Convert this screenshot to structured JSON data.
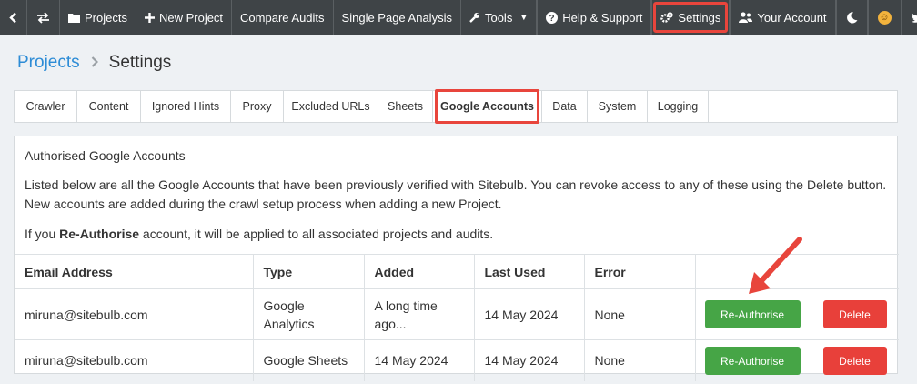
{
  "nav": {
    "projects": "Projects",
    "new_project": "New Project",
    "compare_audits": "Compare Audits",
    "single_page": "Single Page Analysis",
    "tools": "Tools",
    "help": "Help & Support",
    "settings": "Settings",
    "account": "Your Account"
  },
  "breadcrumb": {
    "parent": "Projects",
    "current": "Settings"
  },
  "tabs": [
    "Crawler",
    "Content",
    "Ignored Hints",
    "Proxy",
    "Excluded URLs",
    "Sheets",
    "Google Accounts",
    "Data",
    "System",
    "Logging"
  ],
  "panel": {
    "title": "Authorised Google Accounts",
    "line1": "Listed below are all the Google Accounts that have been previously verified with Sitebulb. You can revoke access to any of these using the Delete button.",
    "line2": "New accounts are added during the crawl setup process when adding a new Project.",
    "line3_prefix": "If you ",
    "line3_bold": "Re-Authorise",
    "line3_suffix": " account, it will be applied to all associated projects and audits."
  },
  "table": {
    "headers": [
      "Email Address",
      "Type",
      "Added",
      "Last Used",
      "Error",
      ""
    ],
    "rows": [
      {
        "email": "miruna@sitebulb.com",
        "type": "Google Analytics",
        "added": "A long time ago...",
        "last_used": "14 May 2024",
        "error": "None",
        "reauth": "Re-Authorise",
        "delete": "Delete"
      },
      {
        "email": "miruna@sitebulb.com",
        "type": "Google Sheets",
        "added": "14 May 2024",
        "last_used": "14 May 2024",
        "error": "None",
        "reauth": "Re-Authorise",
        "delete": "Delete"
      }
    ]
  },
  "colors": {
    "nav_bg": "#3f4447",
    "link": "#2d8cd6",
    "highlight": "#e8453c",
    "success": "#46a546",
    "danger": "#e8403a"
  }
}
